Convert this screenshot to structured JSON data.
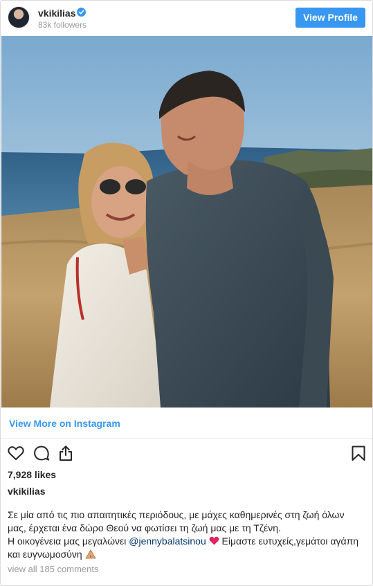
{
  "header": {
    "username": "vkikilias",
    "followers": "83k followers",
    "view_profile_label": "View Profile"
  },
  "view_more_label": "View More on Instagram",
  "likes": "7,928 likes",
  "caption": {
    "username": "vkikilias",
    "line1": "Σε μία από τις πιο απαιτητικές περιόδους, με μάχες καθημερινές στη ζωή όλων",
    "line2": "μας, έρχεται ένα δώρο Θεού να φωτίσει τη ζωή μας με τη Τζένη.",
    "line3_prefix": "Η οικογένεια μας μεγαλώνει ",
    "mention": "@jennybalatsinou",
    "line3_suffix": " Είμαστε ευτυχείς,γεμάτοι αγάπη",
    "line4": "και ευγνωμοσύνη"
  },
  "comments_link": "view all 185 comments",
  "icons": [
    "verified-badge-icon",
    "heart-icon",
    "comment-icon",
    "share-icon",
    "bookmark-icon",
    "red-heart-emoji",
    "praying-hands-emoji"
  ],
  "colors": {
    "accent": "#3897f0",
    "text": "#262626",
    "muted": "#999999",
    "mention": "#003569"
  }
}
